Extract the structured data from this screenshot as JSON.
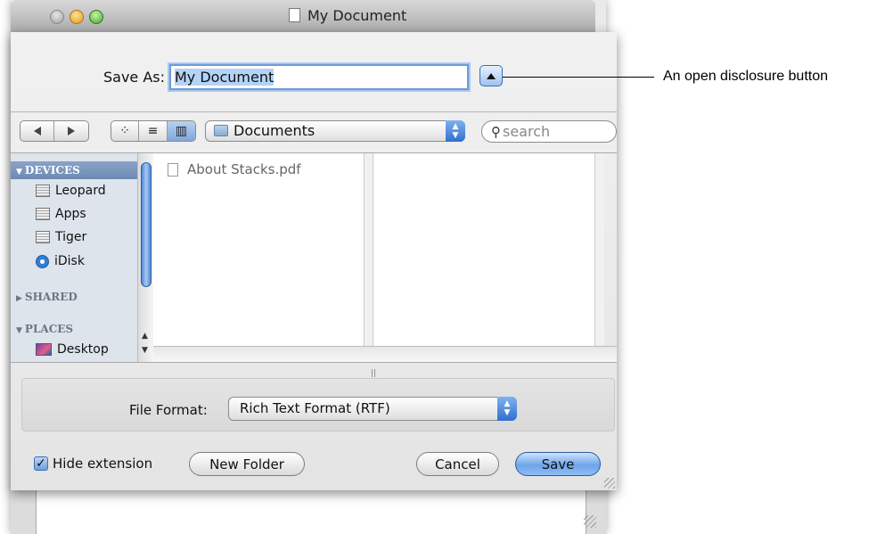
{
  "window": {
    "title": "My Document"
  },
  "save_as": {
    "label": "Save As:",
    "value": "My Document"
  },
  "toolbar": {
    "location": "Documents",
    "search_placeholder": "search",
    "back_icon": "back-arrow-icon",
    "forward_icon": "forward-arrow-icon",
    "view_modes": [
      "icon-view",
      "list-view",
      "column-view"
    ],
    "active_view": "column-view"
  },
  "sidebar": {
    "sections": [
      {
        "title": "DEVICES",
        "expanded": true,
        "items": [
          {
            "label": "Leopard",
            "icon": "hard-disk-icon"
          },
          {
            "label": "Apps",
            "icon": "hard-disk-icon"
          },
          {
            "label": "Tiger",
            "icon": "hard-disk-icon"
          },
          {
            "label": "iDisk",
            "icon": "idisk-icon"
          }
        ]
      },
      {
        "title": "SHARED",
        "expanded": false,
        "items": []
      },
      {
        "title": "PLACES",
        "expanded": true,
        "items": [
          {
            "label": "Desktop",
            "icon": "desktop-icon"
          }
        ]
      }
    ]
  },
  "browser": {
    "files": [
      {
        "name": "About Stacks.pdf",
        "icon": "pdf-file-icon"
      }
    ]
  },
  "options": {
    "file_format_label": "File Format:",
    "file_format_value": "Rich Text Format (RTF)"
  },
  "bottom": {
    "hide_extension_label": "Hide extension",
    "hide_extension_checked": true,
    "new_folder": "New Folder",
    "cancel": "Cancel",
    "save": "Save"
  },
  "callout": {
    "text": "An open disclosure button"
  },
  "colors": {
    "accent": "#6ea5ea",
    "sidebar_bg": "#dee4ec",
    "selection": "#b4d3f7"
  }
}
